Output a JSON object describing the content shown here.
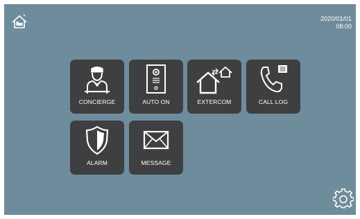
{
  "screen": {
    "background": "#6f8c9c",
    "tile_color": "#3e3f41"
  },
  "header": {
    "home_icon": "home-icon",
    "date": "2020/01/01",
    "time": "08:00"
  },
  "tiles": [
    {
      "label": "CONCIERGE",
      "icon": "concierge-icon"
    },
    {
      "label": "AUTO ON",
      "icon": "door-station-icon"
    },
    {
      "label": "EXTERCOM",
      "icon": "extercom-icon"
    },
    {
      "label": "CALL LOG",
      "icon": "call-log-icon"
    },
    {
      "label": "ALARM",
      "icon": "shield-icon"
    },
    {
      "label": "MESSAGE",
      "icon": "envelope-icon"
    }
  ],
  "footer": {
    "settings_icon": "gear-icon"
  }
}
